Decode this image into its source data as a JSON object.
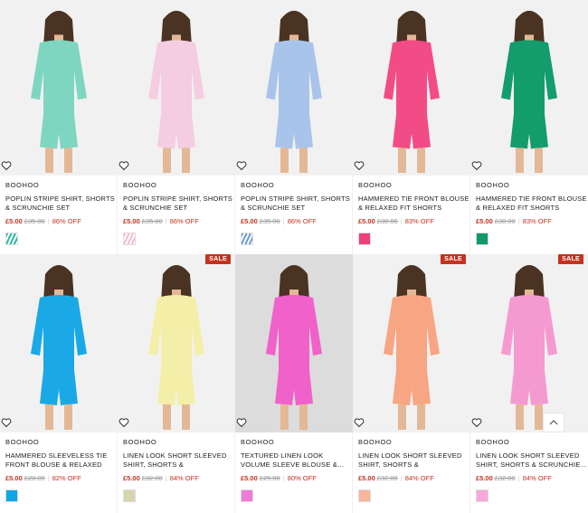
{
  "colors": {
    "sale_red": "#c6321e",
    "price_red": "#c6321e"
  },
  "products": [
    {
      "brand": "BOOHOO",
      "title": "POPLIN STRIPE SHIRT, SHORTS & SCRUNCHIE SET",
      "price": "£5.00",
      "was": "£35.00",
      "off": "86% OFF",
      "sale": "",
      "swatch": "#2db9a0",
      "swatch_pattern": "stripe",
      "outfit": "#7fd6c0",
      "bg": "#f1f1f1"
    },
    {
      "brand": "BOOHOO",
      "title": "POPLIN STRIPE SHIRT, SHORTS & SCRUNCHIE SET",
      "price": "£5.00",
      "was": "£35.00",
      "off": "86% OFF",
      "sale": "",
      "swatch": "#f2b8d6",
      "swatch_pattern": "stripe",
      "outfit": "#f4cde2",
      "bg": "#f1f1f1"
    },
    {
      "brand": "BOOHOO",
      "title": "POPLIN STRIPE SHIRT, SHORTS & SCRUNCHIE SET",
      "price": "£5.00",
      "was": "£35.00",
      "off": "86% OFF",
      "sale": "",
      "swatch": "#6c9ad6",
      "swatch_pattern": "stripe",
      "outfit": "#a9c4ea",
      "bg": "#f1f1f1"
    },
    {
      "brand": "BOOHOO",
      "title": "HAMMERED TIE FRONT BLOUSE & RELAXED FIT SHORTS",
      "price": "£5.00",
      "was": "£30.00",
      "off": "83% OFF",
      "sale": "",
      "swatch": "#f0407e",
      "swatch_pattern": "solid",
      "outfit": "#f24c86",
      "bg": "#f1f1f1"
    },
    {
      "brand": "BOOHOO",
      "title": "HAMMERED TIE FRONT BLOUSE & RELAXED FIT SHORTS",
      "price": "£5.00",
      "was": "£30.00",
      "off": "83% OFF",
      "sale": "",
      "swatch": "#0f9a6b",
      "swatch_pattern": "solid",
      "outfit": "#139c6c",
      "bg": "#f1f1f1"
    },
    {
      "brand": "BOOHOO",
      "title": "HAMMERED SLEEVELESS TIE FRONT BLOUSE & RELAXED FIT…",
      "price": "£5.00",
      "was": "£28.00",
      "off": "82% OFF",
      "sale": "",
      "swatch": "#0ea7e3",
      "swatch_pattern": "solid",
      "outfit": "#1aa9e6",
      "bg": "#f1f1f1"
    },
    {
      "brand": "BOOHOO",
      "title": "LINEN LOOK SHORT SLEEVED SHIRT, SHORTS & SCRUNCHIE…",
      "price": "£5.00",
      "was": "£32.00",
      "off": "84% OFF",
      "sale": "SALE",
      "swatch": "#d7d5ad",
      "swatch_pattern": "solid",
      "outfit": "#f4efa8",
      "bg": "#f1f1f1"
    },
    {
      "brand": "BOOHOO",
      "title": "TEXTURED LINEN LOOK VOLUME SLEEVE BLOUSE &…",
      "price": "£5.00",
      "was": "£25.00",
      "off": "80% OFF",
      "sale": "",
      "swatch": "#f07ad6",
      "swatch_pattern": "solid",
      "outfit": "#f062c9",
      "bg": "#dcdcdc"
    },
    {
      "brand": "BOOHOO",
      "title": "LINEN LOOK SHORT SLEEVED SHIRT, SHORTS & SCRUNCHIE…",
      "price": "£5.00",
      "was": "£32.00",
      "off": "84% OFF",
      "sale": "SALE",
      "swatch": "#f6b79c",
      "swatch_pattern": "solid",
      "outfit": "#f8a583",
      "bg": "#f1f1f1"
    },
    {
      "brand": "BOOHOO",
      "title": "LINEN LOOK SHORT SLEEVED SHIRT, SHORTS & SCRUNCHIE…",
      "price": "£5.00",
      "was": "£32.00",
      "off": "84% OFF",
      "sale": "SALE",
      "swatch": "#f6a8dc",
      "swatch_pattern": "solid",
      "outfit": "#f59ad0",
      "bg": "#f1f1f1"
    }
  ],
  "icons": {
    "wishlist": "heart-icon",
    "back_to_top": "chevron-up-icon"
  }
}
